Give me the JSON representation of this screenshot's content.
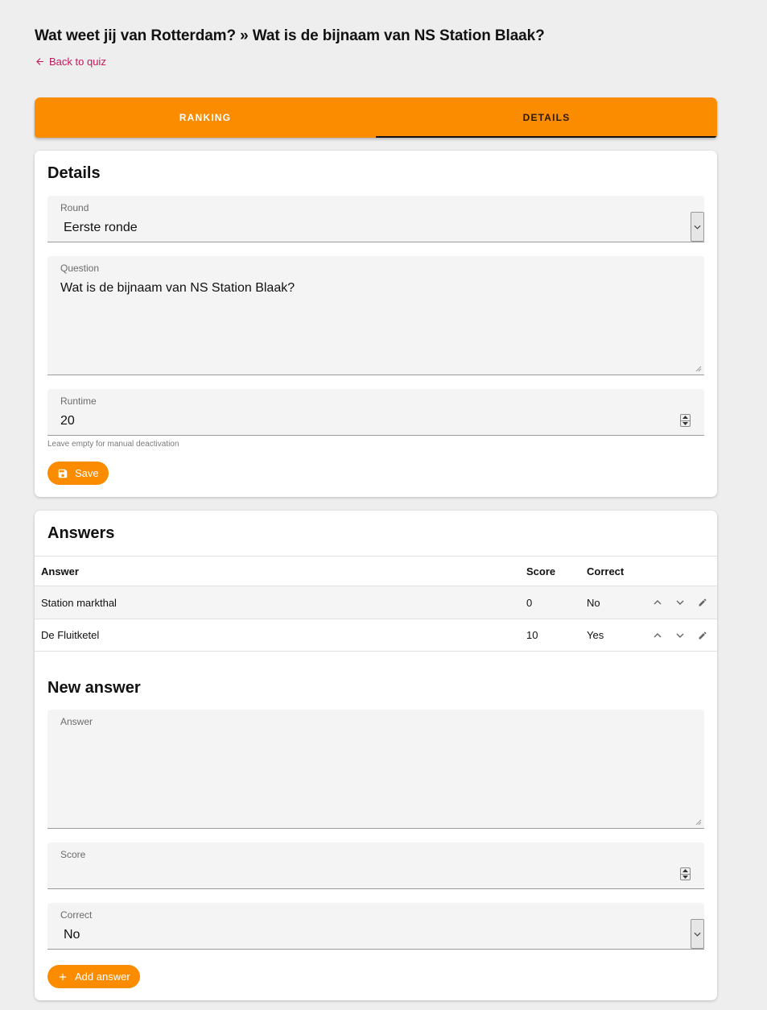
{
  "header": {
    "title": "Wat weet jij van Rotterdam? » Wat is de bijnaam van NS Station Blaak?",
    "back_label": "Back to quiz"
  },
  "tabs": [
    {
      "label": "RANKING",
      "active": false
    },
    {
      "label": "DETAILS",
      "active": true
    }
  ],
  "details": {
    "title": "Details",
    "round": {
      "label": "Round",
      "value": "Eerste ronde"
    },
    "question": {
      "label": "Question",
      "value": "Wat is de bijnaam van NS Station Blaak?"
    },
    "runtime": {
      "label": "Runtime",
      "value": "20",
      "hint": "Leave empty for manual deactivation"
    },
    "save_label": "Save"
  },
  "answers": {
    "title": "Answers",
    "columns": {
      "answer": "Answer",
      "score": "Score",
      "correct": "Correct"
    },
    "rows": [
      {
        "answer": "Station markthal",
        "score": "0",
        "correct": "No"
      },
      {
        "answer": "De Fluitketel",
        "score": "10",
        "correct": "Yes"
      }
    ]
  },
  "new_answer": {
    "title": "New answer",
    "answer": {
      "label": "Answer",
      "value": ""
    },
    "score": {
      "label": "Score",
      "value": ""
    },
    "correct": {
      "label": "Correct",
      "value": "No"
    },
    "add_label": "Add answer"
  },
  "colors": {
    "accent": "#fb8c00",
    "link": "#c2185b",
    "background": "#eeeeee"
  },
  "icons": [
    "arrow-left-icon",
    "chevron-down-icon",
    "spinner-icon",
    "save-icon",
    "chevron-up-icon",
    "pencil-icon",
    "plus-icon",
    "resize-grip-icon"
  ]
}
